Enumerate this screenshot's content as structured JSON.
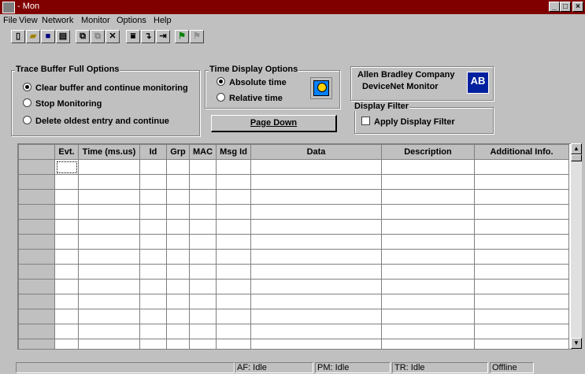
{
  "window": {
    "title": "- Mon"
  },
  "menu": [
    {
      "label": "File"
    },
    {
      "label": "View"
    },
    {
      "label": "Network"
    },
    {
      "label": "Monitor"
    },
    {
      "label": "Options"
    },
    {
      "label": "Help"
    }
  ],
  "toolbar": {
    "buttons": [
      {
        "icon": "new-doc-icon"
      },
      {
        "icon": "open-folder-icon"
      },
      {
        "icon": "save-disk-icon"
      },
      {
        "icon": "print-icon"
      },
      {
        "icon": "connect-icon"
      },
      {
        "icon": "disconnect-icon"
      },
      {
        "icon": "delete-x-icon"
      },
      {
        "icon": "filter-lines-icon"
      },
      {
        "icon": "step-arrow-icon"
      },
      {
        "icon": "split-icon"
      },
      {
        "icon": "green-flag-icon"
      },
      {
        "icon": "gray-flag-icon"
      }
    ]
  },
  "trace_buffer": {
    "title": "Trace Buffer Full Options",
    "options": [
      {
        "label": "Clear buffer and continue monitoring",
        "selected": true
      },
      {
        "label": "Stop Monitoring",
        "selected": false
      },
      {
        "label": "Delete oldest entry and continue",
        "selected": false
      }
    ]
  },
  "time_display": {
    "title": "Time Display Options",
    "options": [
      {
        "label": "Absolute time",
        "selected": true
      },
      {
        "label": "Relative time",
        "selected": false
      }
    ]
  },
  "page_down": "Page Down",
  "company": {
    "line1": "Allen Bradley Company",
    "line2": "DeviceNet Monitor",
    "logo": "AB"
  },
  "display_filter": {
    "title": "Display Filter",
    "checkbox_label": "Apply Display Filter",
    "checked": false
  },
  "grid": {
    "columns": [
      "Evt.",
      "Time (ms.us)",
      "Id",
      "Grp",
      "MAC",
      "Msg Id",
      "Data",
      "Description",
      "Additional Info."
    ]
  },
  "status": {
    "panes": [
      "AF: Idle",
      "PM: Idle",
      "TR: Idle",
      "Offline"
    ]
  },
  "colors": {
    "titlebar": "#800000",
    "face": "#c0c0c0"
  }
}
